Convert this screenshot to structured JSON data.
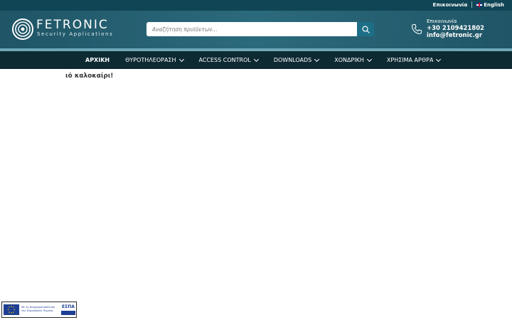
{
  "topbar": {
    "contact_link": "Επικοινωνία",
    "language_label": "English"
  },
  "logo": {
    "name": "FETRONIC",
    "tagline": "Security Applications"
  },
  "search": {
    "placeholder": "Αναζήτηση προϊόντων..."
  },
  "contact": {
    "label": "Επικοινωνία",
    "phone": "+30 2109421802",
    "email": "info@fetronic.gr"
  },
  "nav": {
    "items": [
      {
        "label": "ΑΡΧΙΚΗ"
      },
      {
        "label": "ΘΥΡΟΤΗΛΕΟΡΑΣΗ"
      },
      {
        "label": "ACCESS CONTROL"
      },
      {
        "label": "DOWNLOADS"
      },
      {
        "label": "ΧΟΝΔΡΙΚΗ"
      },
      {
        "label": "ΧΡΗΣΙΜΑ ΑΡΘΡΑ"
      }
    ]
  },
  "main": {
    "greeting": "ιό καλοκαίρι!"
  },
  "espa_banner": {
    "text": "Με τη συγχρηματοδότηση της Ευρωπαϊκής Ένωσης",
    "logo_text": "ΕΣΠΑ"
  },
  "colors": {
    "topbar": "#0f4554",
    "header": "#2b6a7c",
    "nav": "#0d2a33",
    "search_button": "#1d6f87"
  }
}
